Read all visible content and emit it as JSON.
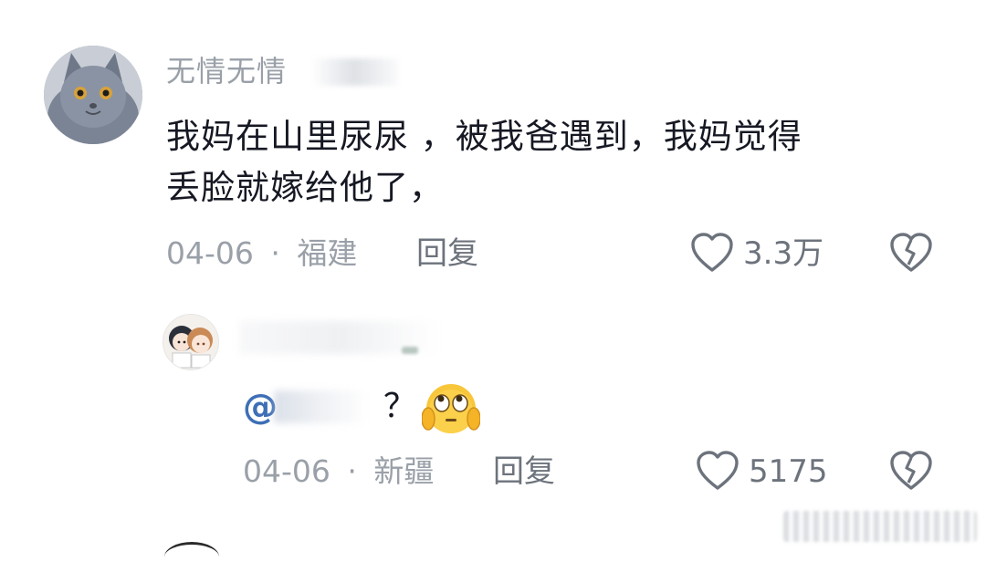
{
  "comments": [
    {
      "username": "无情无情",
      "text_line1": "我妈在山里尿尿 ，被我爸遇到，我妈觉得",
      "text_line2": "丢脸就嫁给他了，",
      "date": "04-06",
      "separator": "·",
      "location": "福建",
      "reply_label": "回复",
      "like_count": "3.3万"
    }
  ],
  "reply": {
    "mention_at": "@",
    "text": "？",
    "emoji": "rolling-eyes-hands-on-ears-emoji",
    "date": "04-06",
    "separator": "·",
    "location": "新疆",
    "reply_label": "回复",
    "like_count": "5175"
  },
  "icons": {
    "like": "heart-outline-icon",
    "dislike": "broken-heart-icon"
  },
  "colors": {
    "text": "#161823",
    "meta": "#9aa0a8",
    "mention": "#3e6fb6"
  }
}
